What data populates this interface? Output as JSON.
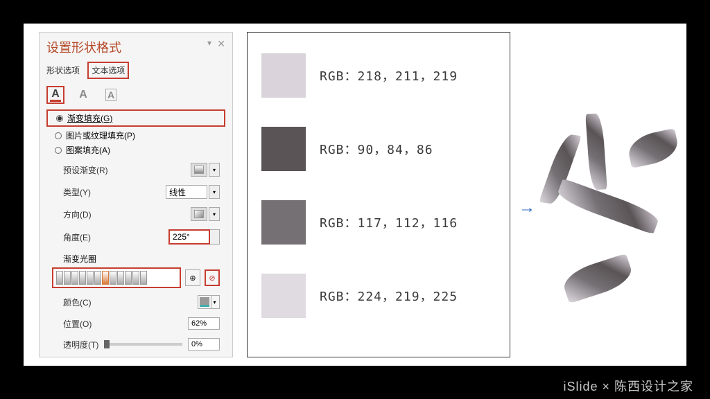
{
  "panel": {
    "title": "设置形状格式",
    "tabs": {
      "shape": "形状选项",
      "text": "文本选项"
    },
    "icons": {
      "a": "A",
      "b": "A",
      "c": "A"
    },
    "fill": {
      "gradient": "渐变填充(G)",
      "picture": "图片或纹理填充(P)",
      "pattern": "图案填充(A)"
    },
    "preset": {
      "label": "预设渐变(R)"
    },
    "type": {
      "label": "类型(Y)",
      "value": "线性"
    },
    "direction": {
      "label": "方向(D)"
    },
    "angle": {
      "label": "角度(E)",
      "value": "225°"
    },
    "stops_label": "渐变光圈",
    "color": {
      "label": "颜色(C)"
    },
    "position": {
      "label": "位置(O)",
      "value": "62%"
    },
    "transparency": {
      "label": "透明度(T)",
      "value": "0%"
    }
  },
  "swatches": [
    {
      "color": "#dad3db",
      "text": "RGB：218，211，219"
    },
    {
      "color": "#5a5456",
      "text": "RGB：90，84，86"
    },
    {
      "color": "#757074",
      "text": "RGB：117，112，116"
    },
    {
      "color": "#e0dbe1",
      "text": "RGB：224，219，225"
    }
  ],
  "arrow": "→",
  "watermark": "iSlide × 陈西设计之家"
}
